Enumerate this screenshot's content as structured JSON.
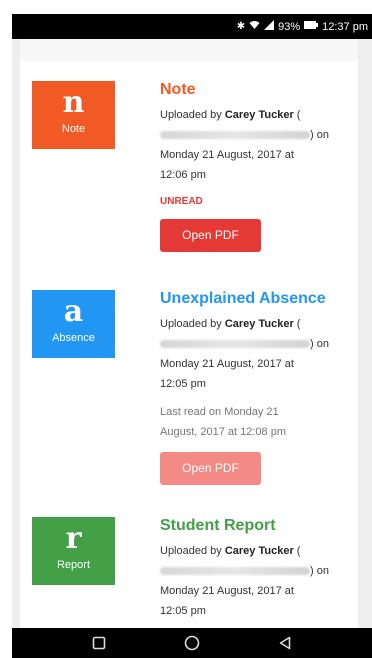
{
  "status_bar": {
    "bluetooth_icon": "bluetooth-icon",
    "wifi_icon": "wifi-icon",
    "signal_icon": "signal-icon",
    "battery_text": "93%",
    "battery_icon": "battery-icon",
    "time": "12:37 pm"
  },
  "items": [
    {
      "badge_letter": "n",
      "badge_caption": "Note",
      "badge_color": "#f15a24",
      "title": "Note",
      "title_color": "#f15a24",
      "uploaded_prefix": "Uploaded by",
      "uploader": "Carey Tucker",
      "paren_open": "(",
      "paren_close": ") on",
      "date_line1": "Monday 21 August, 2017 at",
      "date_line2": "12:06 pm",
      "status": "UNREAD",
      "button_label": "Open PDF",
      "button_color": "#e53935"
    },
    {
      "badge_letter": "a",
      "badge_caption": "Absence",
      "badge_color": "#2196f3",
      "title": "Unexplained Absence",
      "title_color": "#2196f3",
      "uploaded_prefix": "Uploaded by",
      "uploader": "Carey Tucker",
      "paren_open": "(",
      "paren_close": ") on",
      "date_line1": "Monday 21 August, 2017 at",
      "date_line2": "12:05 pm",
      "last_read_line1": "Last read on Monday 21",
      "last_read_line2": "August, 2017 at 12:08 pm",
      "button_label": "Open PDF",
      "button_color": "#f48a86"
    },
    {
      "badge_letter": "r",
      "badge_caption": "Report",
      "badge_color": "#43a047",
      "title": "Student Report",
      "title_color": "#43a047",
      "uploaded_prefix": "Uploaded by",
      "uploader": "Carey Tucker",
      "paren_open": "(",
      "paren_close": ") on",
      "date_line1": "Monday 21 August, 2017 at",
      "date_line2": "12:05 pm"
    }
  ],
  "nav": {
    "recent_icon": "square-icon",
    "home_icon": "circle-icon",
    "back_icon": "triangle-back-icon"
  }
}
